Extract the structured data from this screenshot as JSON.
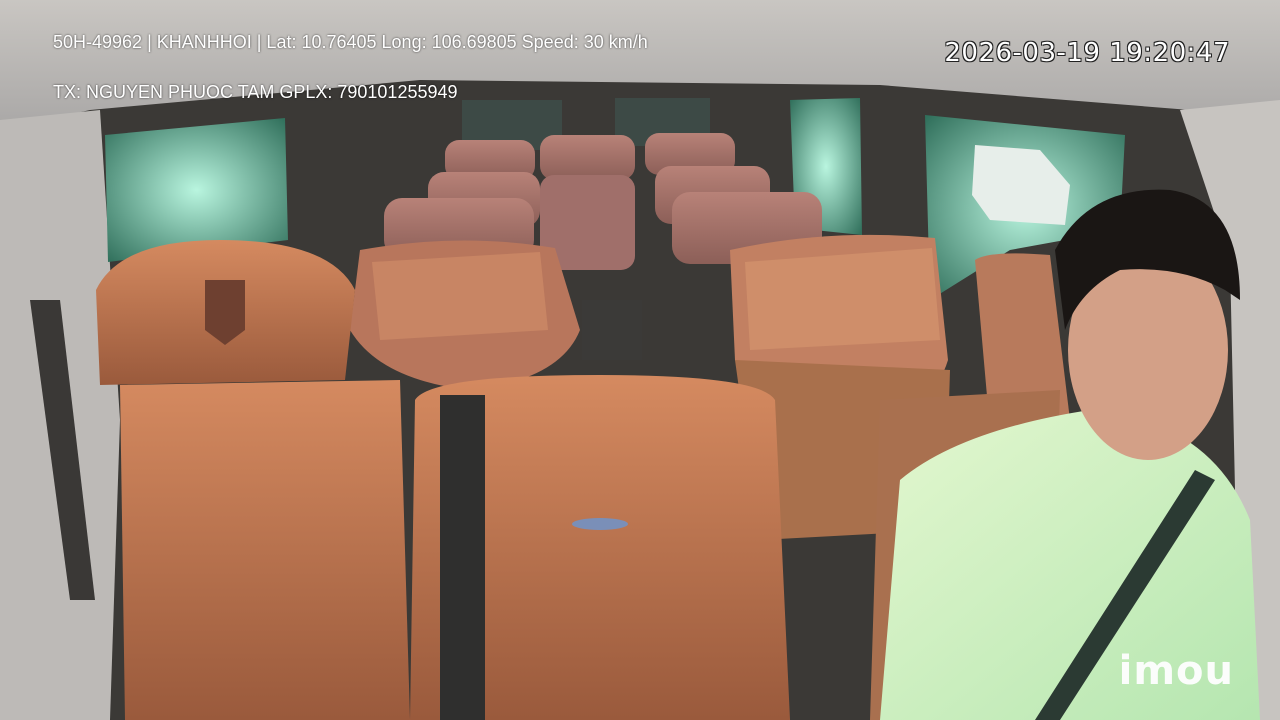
{
  "overlay": {
    "info_line": "50H-49962 | KHANHHOI | Lat: 10.76405 Long: 106.69805 Speed: 30 km/h",
    "driver_line": "TX: NGUYEN PHUOC TAM GPLX: 790101255949",
    "timestamp": "2026-03-19 19:20:47",
    "logo": "imou"
  },
  "colors": {
    "seat_leather": "#c8794f",
    "ceiling": "#d8d4cf",
    "window_glow": "#7fe6c8",
    "shirt": "#d8f2b8"
  }
}
